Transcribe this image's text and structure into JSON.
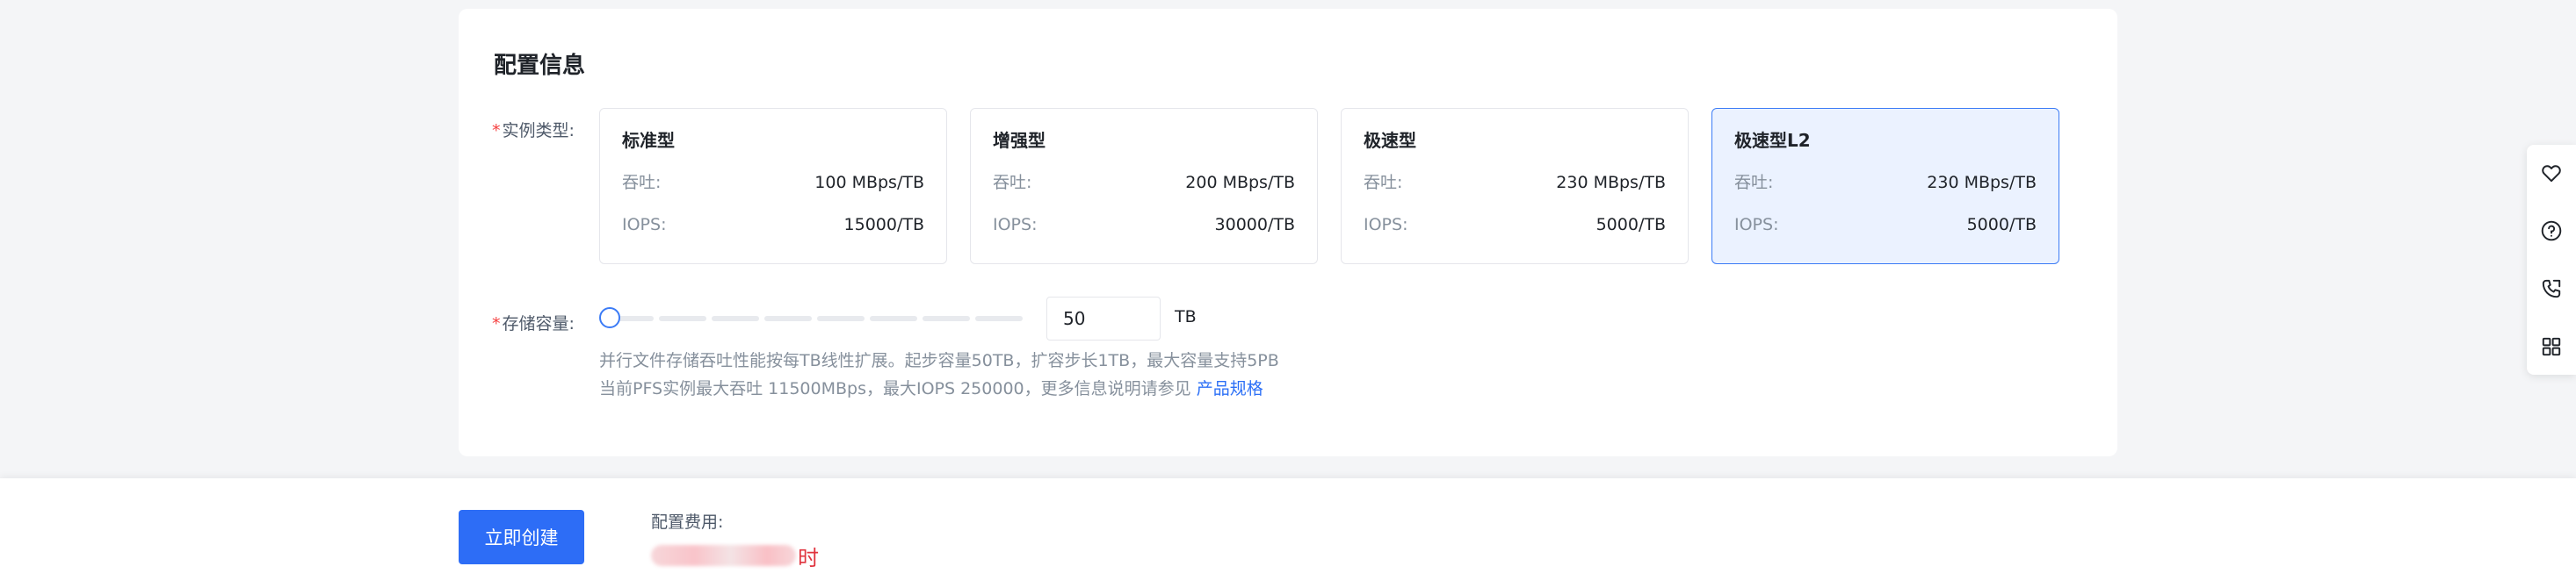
{
  "config": {
    "title": "配置信息",
    "instance_type_label": "实例类型:",
    "types": [
      {
        "name": "标准型",
        "throughput_label": "吞吐:",
        "throughput": "100 MBps/TB",
        "iops_label": "IOPS:",
        "iops": "15000/TB",
        "selected": false
      },
      {
        "name": "增强型",
        "throughput_label": "吞吐:",
        "throughput": "200 MBps/TB",
        "iops_label": "IOPS:",
        "iops": "30000/TB",
        "selected": false
      },
      {
        "name": "极速型",
        "throughput_label": "吞吐:",
        "throughput": "230 MBps/TB",
        "iops_label": "IOPS:",
        "iops": "5000/TB",
        "selected": false
      },
      {
        "name": "极速型L2",
        "throughput_label": "吞吐:",
        "throughput": "230 MBps/TB",
        "iops_label": "IOPS:",
        "iops": "5000/TB",
        "selected": true
      }
    ],
    "capacity_label": "存储容量:",
    "capacity_value": "50",
    "capacity_unit": "TB",
    "capacity_level": 0,
    "hint_line1": "并行文件存储吞吐性能按每TB线性扩展。起步容量50TB，扩容步长1TB，最大容量支持5PB",
    "hint_line2": "当前PFS实例最大吞吐 11500MBps，最大IOPS 250000，更多信息说明请参见",
    "hint_link": "产品规格"
  },
  "footer": {
    "create_button": "立即创建",
    "fee_label": "配置费用:",
    "fee_suffix": "时"
  },
  "side_toolbar": {
    "icons": [
      "heart-icon",
      "help-icon",
      "phone-icon",
      "grid-icon"
    ]
  },
  "colors": {
    "accent": "#2d6df6",
    "selected_bg": "#ebf2ff",
    "required": "#f53f3f",
    "price": "#e0343e"
  }
}
